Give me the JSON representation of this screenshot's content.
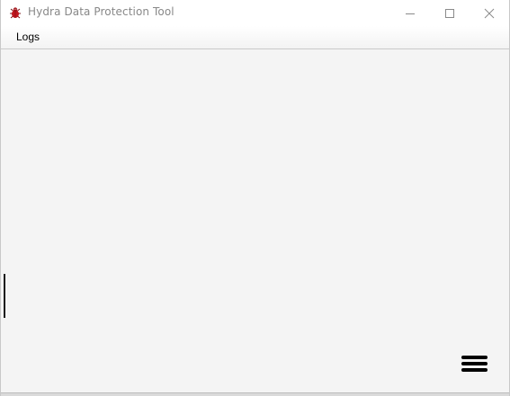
{
  "window": {
    "title": "Hydra Data Protection Tool",
    "app_icon": "hydra-bug-icon",
    "controls": {
      "minimize": "minimize-icon",
      "maximize": "maximize-icon",
      "close": "close-icon"
    }
  },
  "menubar": {
    "items": [
      {
        "label": "Logs"
      }
    ]
  },
  "content": {
    "menu_button_icon": "hamburger-icon"
  },
  "colors": {
    "content_background": "#f4f4f4",
    "title_text": "#888888",
    "app_icon_red": "#c0161e"
  }
}
